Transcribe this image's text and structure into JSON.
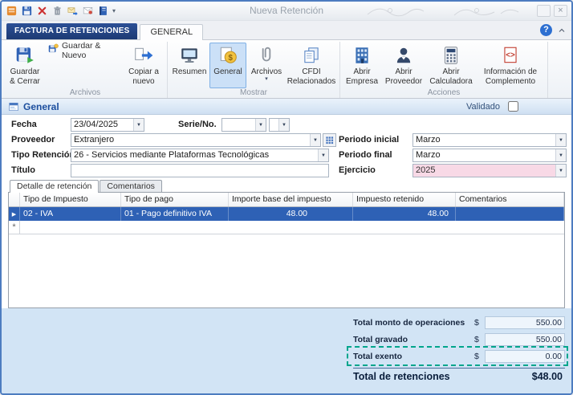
{
  "window": {
    "title": "Nueva Retención",
    "close_glyph": "×"
  },
  "colors": {
    "window_border": "#4d7cc0",
    "context_tab": "#1d3a74",
    "selected_row": "#2e61b5",
    "panel_blue": "#d2e4f5",
    "ejercicio_pink": "#f8d9e6",
    "highlight_dashed": "#00a58c"
  },
  "icons": {
    "dropdown": "▼",
    "help": "?",
    "collapse": "˄",
    "toolbar_more": "▾",
    "split_caret": "▾",
    "row_current": "▶",
    "row_new": "*"
  },
  "quick_access": {
    "icon_names": [
      "app-icon",
      "save-icon",
      "delete-icon",
      "trash-icon",
      "send-icon",
      "mail-icon",
      "ledger-icon",
      "toolbar-options-icon"
    ]
  },
  "ribbon": {
    "tabs": [
      {
        "label": "FACTURA DE RETENCIONES"
      },
      {
        "label": "GENERAL"
      }
    ],
    "groups": [
      {
        "label": "Archivos",
        "buttons": [
          {
            "label": "Guardar & Cerrar"
          },
          {
            "label": "Guardar & Nuevo"
          },
          {
            "label": "Copiar a nuevo"
          }
        ]
      },
      {
        "label": "Mostrar",
        "buttons": [
          {
            "label": "Resumen"
          },
          {
            "label": "General"
          },
          {
            "label": "Archivos"
          },
          {
            "label": "CFDI Relacionados"
          }
        ]
      },
      {
        "label": "Acciones",
        "buttons": [
          {
            "label": "Abrir Empresa"
          },
          {
            "label": "Abrir Proveedor"
          },
          {
            "label": "Abrir Calculadora"
          },
          {
            "label": "Información de Complemento"
          }
        ]
      }
    ]
  },
  "form": {
    "section": {
      "title": "General"
    },
    "validado": {
      "label": "Validado"
    },
    "fecha": {
      "label": "Fecha",
      "value": "23/04/2025"
    },
    "serie": {
      "label": "Serie/No.",
      "serie_value": "",
      "numero_value": ""
    },
    "proveedor": {
      "label": "Proveedor",
      "value": "Extranjero"
    },
    "periodo_inicial": {
      "label": "Periodo inicial",
      "value": "Marzo"
    },
    "tipo_retencion": {
      "label": "Tipo Retención",
      "value": "26 - Servicios mediante Plataformas Tecnológicas"
    },
    "periodo_final": {
      "label": "Periodo final",
      "value": "Marzo"
    },
    "titulo": {
      "label": "Título",
      "value": ""
    },
    "ejercicio": {
      "label": "Ejercicio",
      "value": "2025"
    }
  },
  "detail_tabs": [
    {
      "label": "Detalle de retención"
    },
    {
      "label": "Comentarios"
    }
  ],
  "grid": {
    "columns": [
      "Tipo de Impuesto",
      "Tipo de pago",
      "Importe base del impuesto",
      "Impuesto retenido",
      "Comentarios"
    ],
    "rows": [
      {
        "indicator": "▶",
        "tipo_impuesto": "02 - IVA",
        "tipo_pago": "01 - Pago definitivo IVA",
        "importe_base": "48.00",
        "impuesto_retenido": "48.00",
        "comentarios": ""
      }
    ],
    "new_row_indicator": "*"
  },
  "totals": {
    "currency_symbol": "$",
    "rows": [
      {
        "label": "Total monto de operaciones",
        "value": "550.00"
      },
      {
        "label": "Total gravado",
        "value": "550.00"
      },
      {
        "label": "Total exento",
        "value": "0.00",
        "highlighted": true
      }
    ],
    "grand": {
      "label": "Total de retenciones",
      "value": "$48.00"
    }
  }
}
